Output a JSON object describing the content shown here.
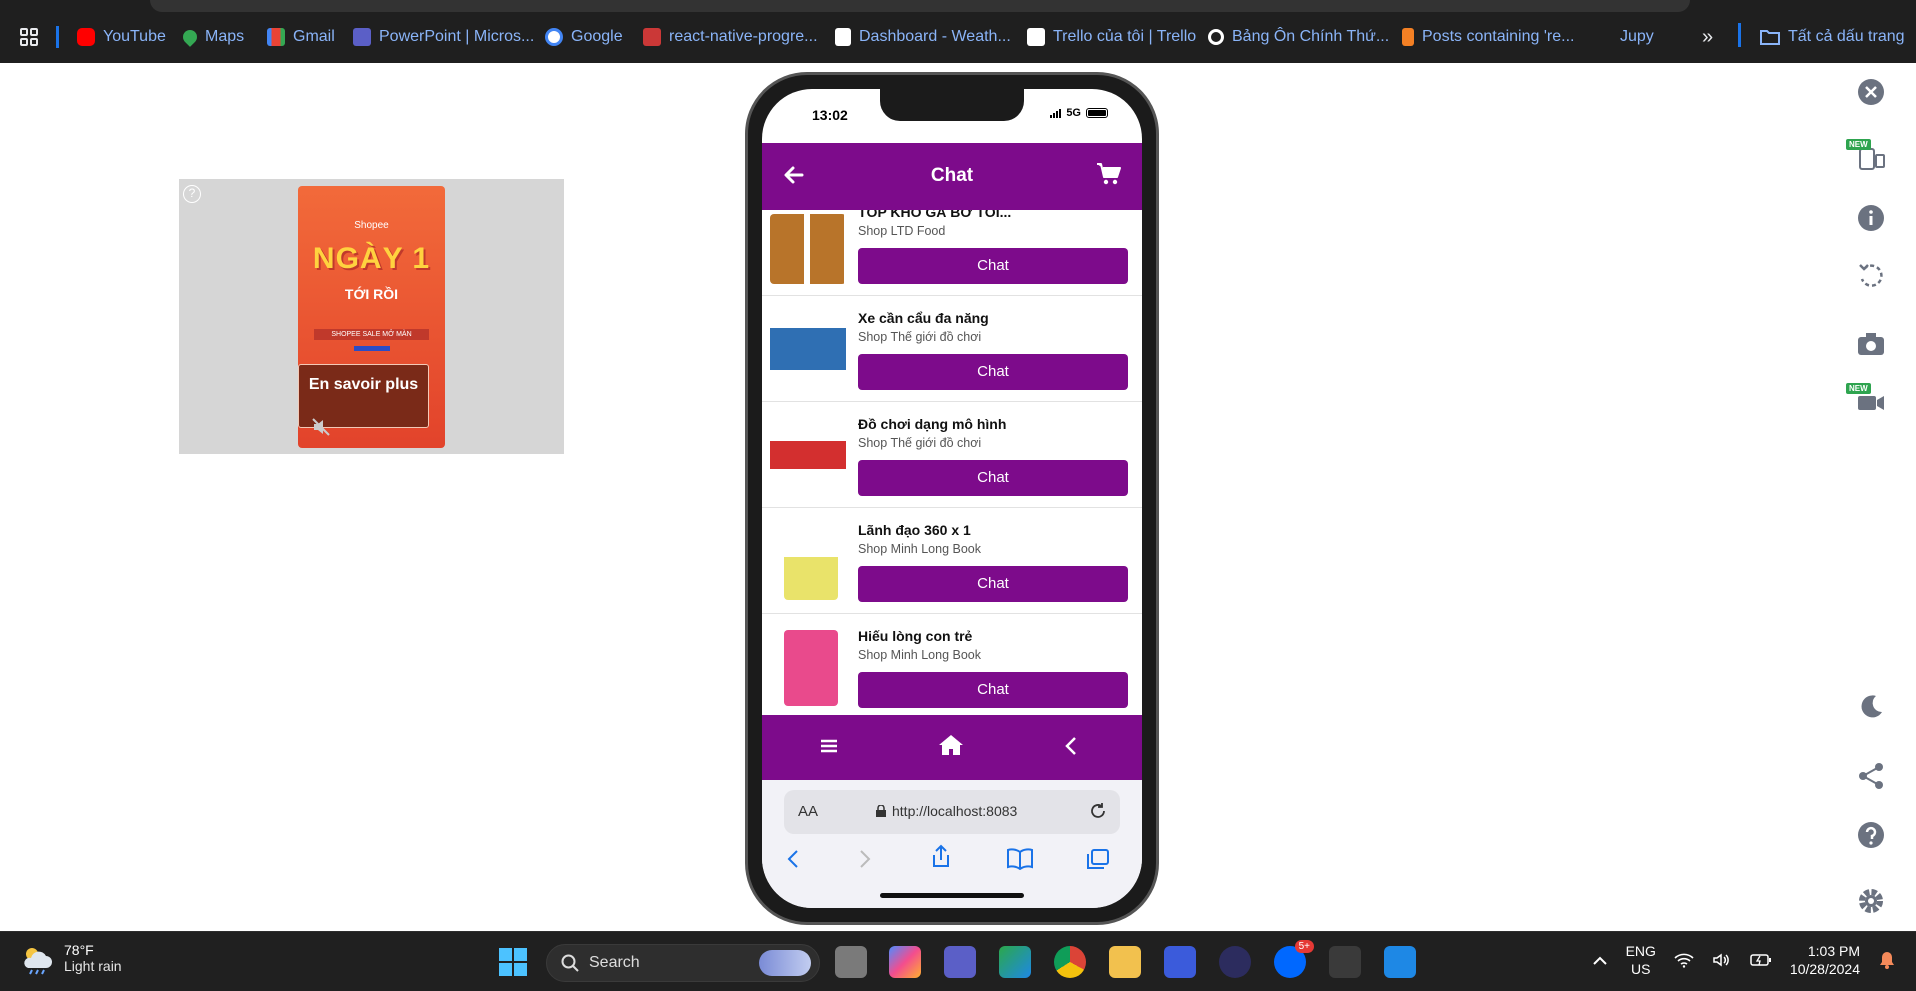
{
  "browser": {
    "bookmarks": [
      {
        "label": "YouTube",
        "icon": "youtube-icon",
        "color": "#ff0000"
      },
      {
        "label": "Maps",
        "icon": "maps-icon",
        "color": "#34a853"
      },
      {
        "label": "Gmail",
        "icon": "gmail-icon",
        "color": "#ea4335"
      },
      {
        "label": "PowerPoint | Micros...",
        "icon": "teams-icon",
        "color": "#5b5fc7"
      },
      {
        "label": "Google",
        "icon": "google-icon",
        "color": "#4285f4"
      },
      {
        "label": "react-native-progre...",
        "icon": "npm-icon",
        "color": "#cb3837"
      },
      {
        "label": "Dashboard - Weath...",
        "icon": "page-icon",
        "color": "#ffffff"
      },
      {
        "label": "Trello của tôi | Trello",
        "icon": "trello-icon",
        "color": "#ffffff"
      },
      {
        "label": "Bảng Ôn Chính Thứ...",
        "icon": "link-icon",
        "color": "#ffffff"
      },
      {
        "label": "Posts containing 're...",
        "icon": "stackoverflow-icon",
        "color": "#f48024"
      },
      {
        "label": "Jupy",
        "icon": "",
        "color": ""
      }
    ],
    "more_label": "»",
    "all_bookmarks_label": "Tất cả dấu trang"
  },
  "ad": {
    "help": "?",
    "brand": "Shopee",
    "headline": "NGÀY 1",
    "subheadline": "TỚI RỒI",
    "tagline": "SHOPEE SALE MỞ MÀN",
    "cta": "En savoir plus"
  },
  "phone": {
    "status": {
      "time": "13:02",
      "network": "5G"
    },
    "appbar": {
      "title": "Chat"
    },
    "products": [
      {
        "name": "TÓP KHÔ GÀ BƠ TỎI...",
        "shop": "Shop LTD Food",
        "button": "Chat",
        "thumb_color": "#b8742a"
      },
      {
        "name": "Xe cần cẩu đa năng",
        "shop": "Shop Thế giới đồ chơi",
        "button": "Chat",
        "thumb_color": "#2f6fb3"
      },
      {
        "name": "Đồ chơi dạng mô hình",
        "shop": "Shop Thế giới đồ chơi",
        "button": "Chat",
        "thumb_color": "#d32f2f"
      },
      {
        "name": "Lãnh đạo 360 x 1",
        "shop": "Shop Minh Long Book",
        "button": "Chat",
        "thumb_color": "#e9e36a"
      },
      {
        "name": "Hiếu lòng con trẻ",
        "shop": "Shop Minh Long Book",
        "button": "Chat",
        "thumb_color": "#e94a8c"
      }
    ],
    "safari": {
      "aa": "AA",
      "url": "http://localhost:8083"
    }
  },
  "taskbar": {
    "weather": {
      "temp": "78°F",
      "condition": "Light rain"
    },
    "search_placeholder": "Search",
    "language": {
      "line1": "ENG",
      "line2": "US"
    },
    "clock": {
      "time": "1:03 PM",
      "date": "10/28/2024"
    },
    "zalo_badge": "5+"
  },
  "side_panel": {
    "new_tag": "NEW"
  },
  "colors": {
    "primary": "#7d0b8b",
    "browser_bg": "#1f1f1f",
    "taskbar_bg": "#202020"
  }
}
